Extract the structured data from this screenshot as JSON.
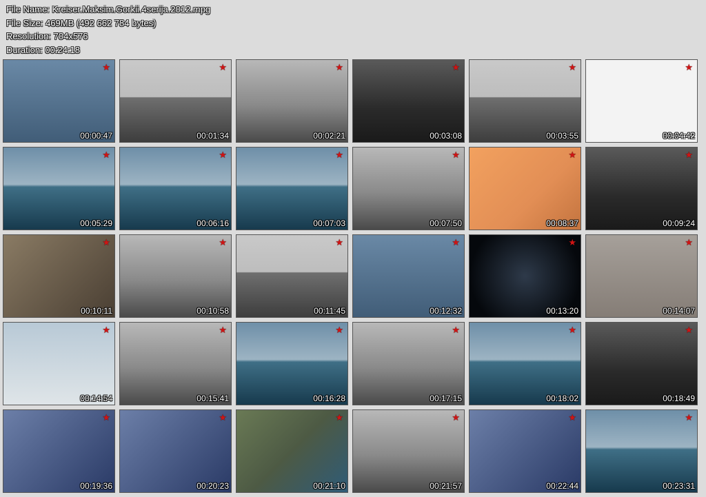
{
  "info": {
    "file_name": "File Name: Kreiser.Maksim.Gorkii.4serija.2012.mpg",
    "file_size": "File Size: 469MB (492 662 784 bytes)",
    "resolution": "Resolution: 704x576",
    "duration": "Duration: 00:24:18"
  },
  "thumbnails": [
    {
      "time": "00:00:47",
      "scene": "s-poster"
    },
    {
      "time": "00:01:34",
      "scene": "s-bw-sea"
    },
    {
      "time": "00:02:21",
      "scene": "s-bw-light"
    },
    {
      "time": "00:03:08",
      "scene": "s-bw-dark"
    },
    {
      "time": "00:03:55",
      "scene": "s-bw-sea"
    },
    {
      "time": "00:04:42",
      "scene": "s-blueprint"
    },
    {
      "time": "00:05:29",
      "scene": "s-sea3d"
    },
    {
      "time": "00:06:16",
      "scene": "s-sea3d"
    },
    {
      "time": "00:07:03",
      "scene": "s-sea3d"
    },
    {
      "time": "00:07:50",
      "scene": "s-bw-light"
    },
    {
      "time": "00:08:37",
      "scene": "s-map"
    },
    {
      "time": "00:09:24",
      "scene": "s-bw-dark"
    },
    {
      "time": "00:10:11",
      "scene": "s-color-portrait"
    },
    {
      "time": "00:10:58",
      "scene": "s-bw-light"
    },
    {
      "time": "00:11:45",
      "scene": "s-bw-sea"
    },
    {
      "time": "00:12:32",
      "scene": "s-poster"
    },
    {
      "time": "00:13:20",
      "scene": "s-dark"
    },
    {
      "time": "00:14:07",
      "scene": "s-metal"
    },
    {
      "time": "00:14:54",
      "scene": "s-sky"
    },
    {
      "time": "00:15:41",
      "scene": "s-bw-light"
    },
    {
      "time": "00:16:28",
      "scene": "s-sea3d"
    },
    {
      "time": "00:17:15",
      "scene": "s-bw-light"
    },
    {
      "time": "00:18:02",
      "scene": "s-sea3d"
    },
    {
      "time": "00:18:49",
      "scene": "s-bw-dark"
    },
    {
      "time": "00:19:36",
      "scene": "s-studio"
    },
    {
      "time": "00:20:23",
      "scene": "s-studio"
    },
    {
      "time": "00:21:10",
      "scene": "s-aerial"
    },
    {
      "time": "00:21:57",
      "scene": "s-bw-light"
    },
    {
      "time": "00:22:44",
      "scene": "s-studio"
    },
    {
      "time": "00:23:31",
      "scene": "s-sea3d"
    }
  ],
  "icons": {
    "channel_logo": "red-star-icon"
  },
  "colors": {
    "background": "#dcdcdc",
    "star": "#d01414",
    "text": "#ffffff"
  }
}
